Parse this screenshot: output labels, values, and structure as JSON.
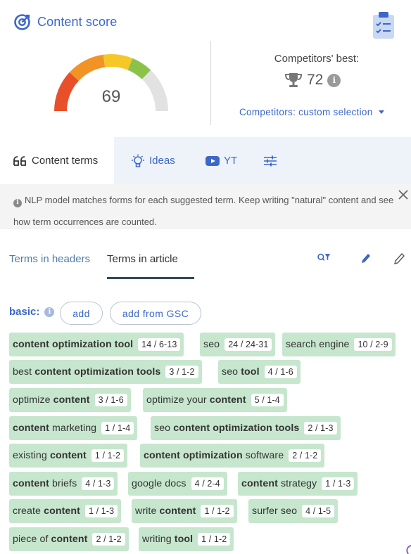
{
  "score": {
    "title": "Content score",
    "value": "69",
    "gauge_level": 69,
    "gauge_colors": [
      "#e8502a",
      "#f29425",
      "#f5c828",
      "#8bc34a",
      "#e2e2e2"
    ],
    "competitors_label": "Competitors' best:",
    "competitors_value": "72",
    "competitors_info": "i",
    "competitors_selection": "Competitors: custom selection"
  },
  "tabs": [
    {
      "label": "Content terms",
      "icon": "quote-icon",
      "active": true
    },
    {
      "label": "Ideas",
      "icon": "lightbulb-icon",
      "active": false
    },
    {
      "label": "YT",
      "icon": "youtube-icon",
      "active": false
    },
    {
      "label": "",
      "icon": "sliders-icon",
      "active": false
    }
  ],
  "notice": {
    "text": "NLP model matches forms for each suggested term. Keep writing \"natural\" content and see how term occurrences are counted.",
    "info": "i"
  },
  "subtabs": {
    "headers": "Terms in headers",
    "article": "Terms in article"
  },
  "basic": {
    "label": "basic:",
    "info": "i",
    "add": "add",
    "add_gsc": "add from GSC"
  },
  "terms": [
    {
      "parts": [
        {
          "t": "content optimization tool",
          "b": true
        }
      ],
      "count": "14 / 6-13"
    },
    {
      "parts": [
        {
          "t": "seo",
          "b": false
        }
      ],
      "count": "24 / 24-31"
    },
    {
      "parts": [
        {
          "t": "search engine",
          "b": false
        }
      ],
      "count": "10 / 2-9"
    },
    {
      "parts": [
        {
          "t": "best ",
          "b": false
        },
        {
          "t": "content optimization tools",
          "b": true
        }
      ],
      "count": "3 / 1-2"
    },
    {
      "parts": [
        {
          "t": "seo ",
          "b": false
        },
        {
          "t": "tool",
          "b": true
        }
      ],
      "count": "4 / 1-6"
    },
    {
      "parts": [
        {
          "t": "optimize ",
          "b": false
        },
        {
          "t": "content",
          "b": true
        }
      ],
      "count": "3 / 1-6"
    },
    {
      "parts": [
        {
          "t": "optimize your ",
          "b": false
        },
        {
          "t": "content",
          "b": true
        }
      ],
      "count": "5 / 1-4"
    },
    {
      "parts": [
        {
          "t": "content",
          "b": true
        },
        {
          "t": " marketing",
          "b": false
        }
      ],
      "count": "1 / 1-4"
    },
    {
      "parts": [
        {
          "t": "seo ",
          "b": false
        },
        {
          "t": "content optimization tools",
          "b": true
        }
      ],
      "count": "2 / 1-3"
    },
    {
      "parts": [
        {
          "t": "existing ",
          "b": false
        },
        {
          "t": "content",
          "b": true
        }
      ],
      "count": "1 / 1-2"
    },
    {
      "parts": [
        {
          "t": "content optimization",
          "b": true
        },
        {
          "t": " software",
          "b": false
        }
      ],
      "count": "2 / 1-2"
    },
    {
      "parts": [
        {
          "t": "content",
          "b": true
        },
        {
          "t": " briefs",
          "b": false
        }
      ],
      "count": "4 / 1-3"
    },
    {
      "parts": [
        {
          "t": "google docs",
          "b": false
        }
      ],
      "count": "4 / 2-4"
    },
    {
      "parts": [
        {
          "t": "content",
          "b": true
        },
        {
          "t": " strategy",
          "b": false
        }
      ],
      "count": "1 / 1-3"
    },
    {
      "parts": [
        {
          "t": "create ",
          "b": false
        },
        {
          "t": "content",
          "b": true
        }
      ],
      "count": "1 / 1-3"
    },
    {
      "parts": [
        {
          "t": "write ",
          "b": false
        },
        {
          "t": "content",
          "b": true
        }
      ],
      "count": "1 / 1-2"
    },
    {
      "parts": [
        {
          "t": "surfer seo",
          "b": false
        }
      ],
      "count": "4 / 1-5"
    },
    {
      "parts": [
        {
          "t": "piece of ",
          "b": false
        },
        {
          "t": "content",
          "b": true
        }
      ],
      "count": "2 / 1-2"
    },
    {
      "parts": [
        {
          "t": "writing ",
          "b": false
        },
        {
          "t": "tool",
          "b": true
        }
      ],
      "count": "1 / 1-2"
    }
  ]
}
